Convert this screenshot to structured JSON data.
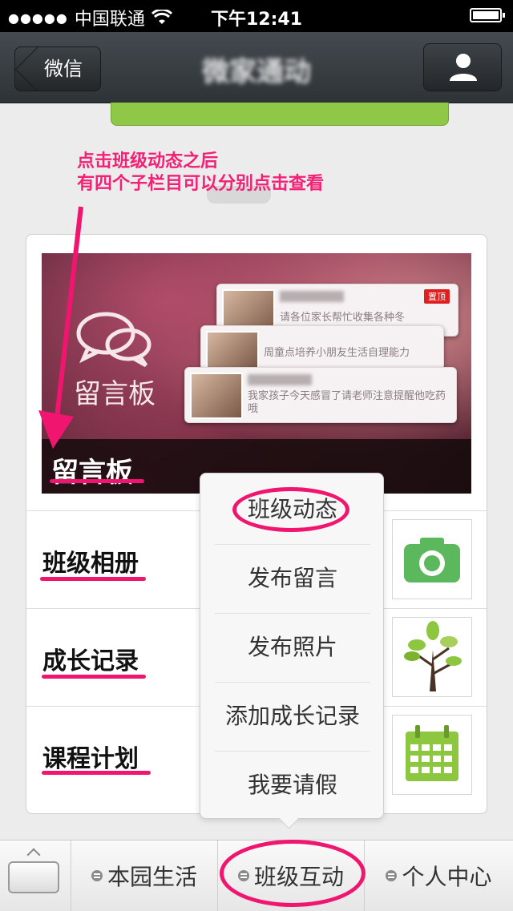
{
  "status_bar": {
    "signal": "●●●●●",
    "carrier": "中国联通",
    "time": "下午12:41"
  },
  "nav": {
    "back_label": "微信",
    "title": "微家通动"
  },
  "annotation": {
    "line1": "点击班级动态之后",
    "line2": "有四个子栏目可以分别点击查看"
  },
  "banner": {
    "logo_text": "留言板",
    "caption": "留言板",
    "messages": [
      {
        "text": "请各位家长帮忙收集各种冬",
        "tag": "置顶"
      },
      {
        "text": "周童点培养小朋友生活自理能力"
      },
      {
        "text": "我家孩子今天感冒了请老师注意提醒他吃药哦"
      }
    ]
  },
  "rows": [
    {
      "label": "班级相册",
      "icon": "camera-icon"
    },
    {
      "label": "成长记录",
      "icon": "tree-icon"
    },
    {
      "label": "课程计划",
      "icon": "calendar-icon"
    }
  ],
  "popup": {
    "items": [
      "班级动态",
      "发布留言",
      "发布照片",
      "添加成长记录",
      "我要请假"
    ]
  },
  "tabs": [
    "本园生活",
    "班级互动",
    "个人中心"
  ],
  "colors": {
    "highlight": "#f0156f",
    "green": "#8fc846"
  }
}
